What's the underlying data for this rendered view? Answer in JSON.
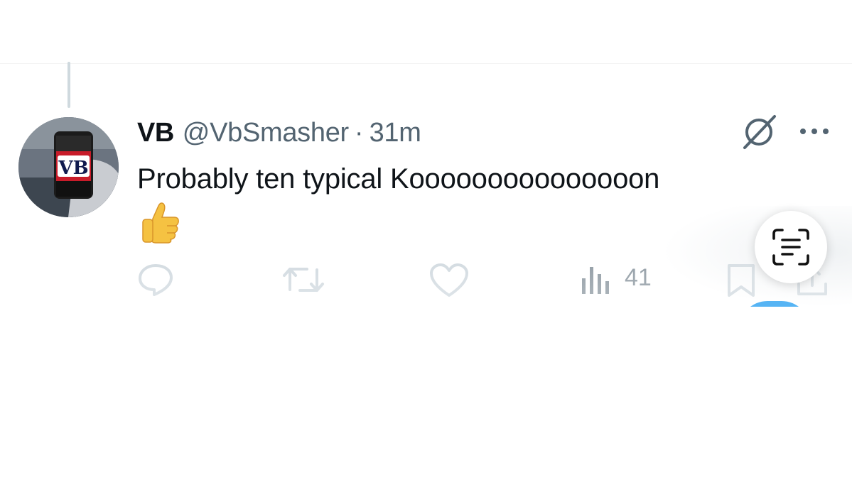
{
  "tweet": {
    "display_name": "VB",
    "handle": "@VbSmasher",
    "separator": "·",
    "timestamp": "31m",
    "text": "Probably ten typical Kooooooooooooooon",
    "emoji": "👍",
    "avatar_can_label": "VB"
  },
  "actions": {
    "views_count": "41"
  },
  "icons": {
    "reply": "reply-icon",
    "repost": "repost-icon",
    "like": "like-icon",
    "views": "views-icon",
    "bookmark": "bookmark-icon",
    "share": "share-icon",
    "grok": "grok-icon",
    "more": "more-icon",
    "live_text": "live-text-icon"
  },
  "colors": {
    "primary_text": "#0f1419",
    "secondary_text": "#536471",
    "action_icon": "#b9c6cf",
    "brand_blue": "#1d9bf0"
  }
}
